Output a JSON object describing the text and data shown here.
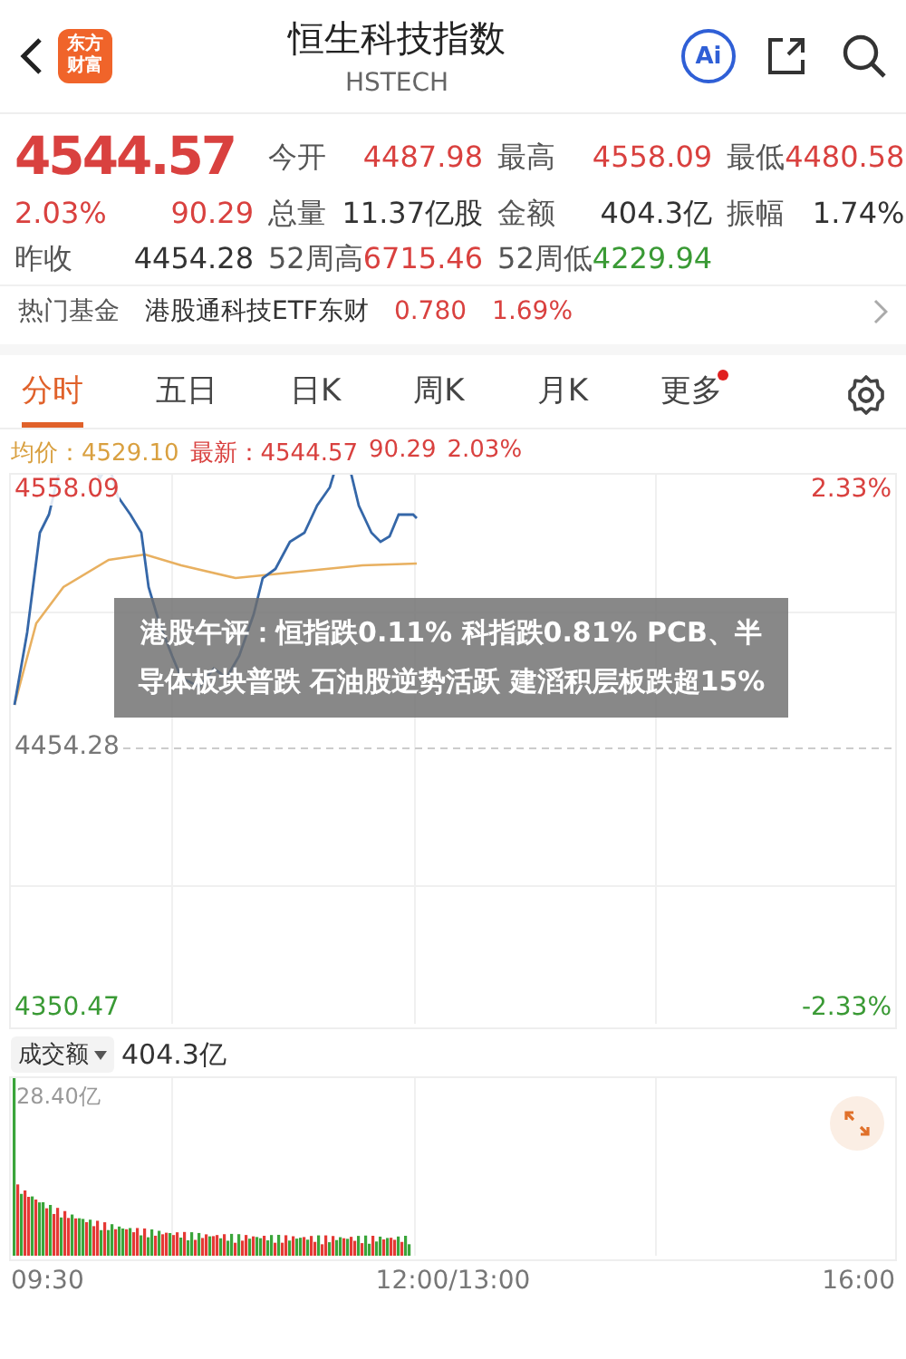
{
  "header": {
    "logo_text": "东方财富",
    "title": "恒生科技指数",
    "code": "HSTECH",
    "ai_label": "Ai"
  },
  "quote": {
    "price": "4544.57",
    "change_pct": "2.03%",
    "change": "90.29",
    "prev_close_label": "昨收",
    "prev_close": "4454.28",
    "stats": [
      {
        "label": "今开",
        "value": "4487.98",
        "color": "#d9413f"
      },
      {
        "label": "最高",
        "value": "4558.09",
        "color": "#d9413f"
      },
      {
        "label": "最低",
        "value": "4480.58",
        "color": "#d9413f"
      },
      {
        "label": "总量",
        "value": "11.37亿股",
        "color": "#333333"
      },
      {
        "label": "金额",
        "value": "404.3亿",
        "color": "#333333"
      },
      {
        "label": "振幅",
        "value": "1.74%",
        "color": "#333333"
      },
      {
        "label": "52周高",
        "value": "6715.46",
        "color": "#d9413f"
      },
      {
        "label": "52周低",
        "value": "4229.94",
        "color": "#3a9a35"
      }
    ]
  },
  "fund": {
    "label": "热门基金",
    "name": "港股通科技ETF东财",
    "price": "0.780",
    "change": "1.69%"
  },
  "tabs": [
    {
      "label": "分时",
      "selected": true,
      "notification": false
    },
    {
      "label": "五日",
      "selected": false,
      "notification": false
    },
    {
      "label": "日K",
      "selected": false,
      "notification": false
    },
    {
      "label": "周K",
      "selected": false,
      "notification": false
    },
    {
      "label": "月K",
      "selected": false,
      "notification": false
    },
    {
      "label": "更多",
      "selected": false,
      "notification": true
    }
  ],
  "info": {
    "avg_label": "均价：",
    "avg": "4529.10",
    "latest_label": "最新：",
    "latest": "4544.57",
    "change": "90.29",
    "change_pct": "2.03%"
  },
  "chart": {
    "high": "4558.09",
    "mid": "4454.28",
    "low": "4350.47",
    "pct_high": "2.33%",
    "pct_low": "-2.33%"
  },
  "volume": {
    "selector": "成交额",
    "value": "404.3亿",
    "max": "28.40亿",
    "times": [
      "09:30",
      "12:00/13:00",
      "16:00"
    ]
  },
  "headline": "港股午评：恒指跌0.11% 科指跌0.81% PCB、半导体板块普跌 石油股逆势活跃 建滔积层板跌超15%"
}
